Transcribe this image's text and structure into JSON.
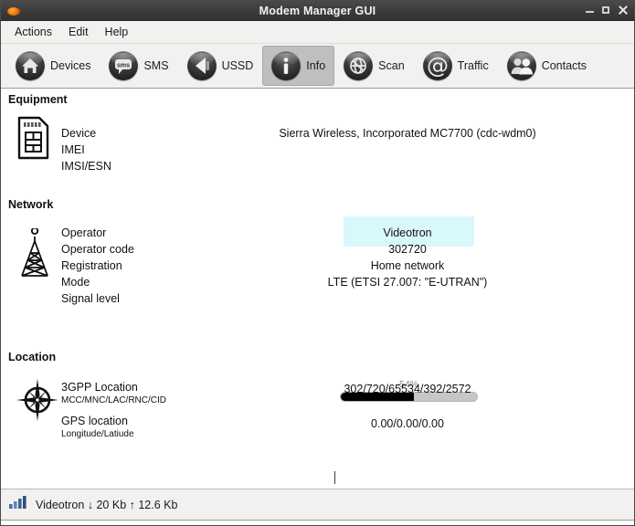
{
  "window": {
    "title": "Modem Manager GUI",
    "app_icon": "flame-icon",
    "controls": {
      "minimize": "minimize-icon",
      "maximize": "maximize-icon",
      "close": "close-icon"
    }
  },
  "menubar": {
    "items": [
      {
        "label": "Actions"
      },
      {
        "label": "Edit"
      },
      {
        "label": "Help"
      }
    ]
  },
  "toolbar": {
    "buttons": [
      {
        "label": "Devices",
        "icon": "home-icon",
        "active": false
      },
      {
        "label": "SMS",
        "icon": "sms-icon",
        "active": false
      },
      {
        "label": "USSD",
        "icon": "ussd-icon",
        "active": false
      },
      {
        "label": "Info",
        "icon": "info-icon",
        "active": true
      },
      {
        "label": "Scan",
        "icon": "globe-icon",
        "active": false
      },
      {
        "label": "Traffic",
        "icon": "at-icon",
        "active": false
      },
      {
        "label": "Contacts",
        "icon": "contacts-icon",
        "active": false
      }
    ]
  },
  "sections": {
    "equipment": {
      "title": "Equipment",
      "icon": "sim-card-icon",
      "rows": [
        {
          "label": "Device",
          "value": "Sierra Wireless, Incorporated MC7700 (cdc-wdm0)"
        },
        {
          "label": "IMEI",
          "value": ""
        },
        {
          "label": "IMSI/ESN",
          "value": ""
        }
      ],
      "redacted": true,
      "redaction_color": "#d8f8fc"
    },
    "network": {
      "title": "Network",
      "icon": "cell-tower-icon",
      "rows": [
        {
          "label": "Operator",
          "value": "Videotron"
        },
        {
          "label": "Operator code",
          "value": "302720"
        },
        {
          "label": "Registration",
          "value": "Home network"
        },
        {
          "label": "Mode",
          "value": "LTE (ETSI 27.007: \"E-UTRAN\")"
        },
        {
          "label": "Signal level",
          "value": ""
        }
      ],
      "signal": {
        "percent_label": "54%",
        "percent": 54,
        "fill_color": "#000000",
        "track_color": "#c6c6c6"
      }
    },
    "location": {
      "title": "Location",
      "icon": "compass-icon",
      "rows": [
        {
          "label": "3GPP Location",
          "sublabel": "MCC/MNC/LAC/RNC/CID",
          "value": "302/720/65534/392/2572"
        },
        {
          "label": "GPS location",
          "sublabel": "Longitude/Latiude",
          "value": "0.00/0.00/0.00"
        }
      ]
    }
  },
  "statusbar": {
    "icon": "signal-bars-icon",
    "text": "Videotron ↓ 20 Kb ↑ 12.6 Kb"
  }
}
